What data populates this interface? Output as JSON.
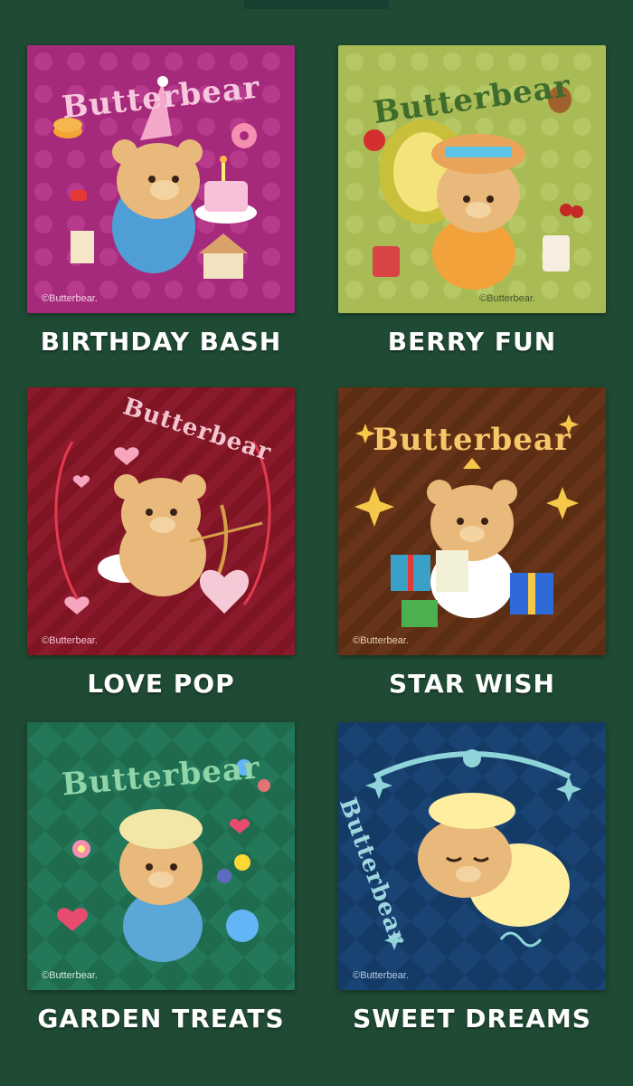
{
  "brand_name": "Butterbear",
  "copyright": "©Butterbear.",
  "colors": {
    "page_background": "#1f4a33",
    "birthday_bash": "#a62a7c",
    "berry_fun": "#a9bb55",
    "love_pop": "#7f1423",
    "star_wish": "#5b2d12",
    "garden_treats": "#1e6b4e",
    "sweet_dreams": "#143a66"
  },
  "cards": [
    {
      "title": "BIRTHDAY BASH",
      "icon": "birthday-cake-icon"
    },
    {
      "title": "BERRY FUN",
      "icon": "durian-fruit-icon"
    },
    {
      "title": "LOVE POP",
      "icon": "cupid-heart-icon"
    },
    {
      "title": "STAR WISH",
      "icon": "gift-star-icon"
    },
    {
      "title": "GARDEN TREATS",
      "icon": "flower-icon"
    },
    {
      "title": "SWEET DREAMS",
      "icon": "sleep-moon-icon"
    }
  ]
}
